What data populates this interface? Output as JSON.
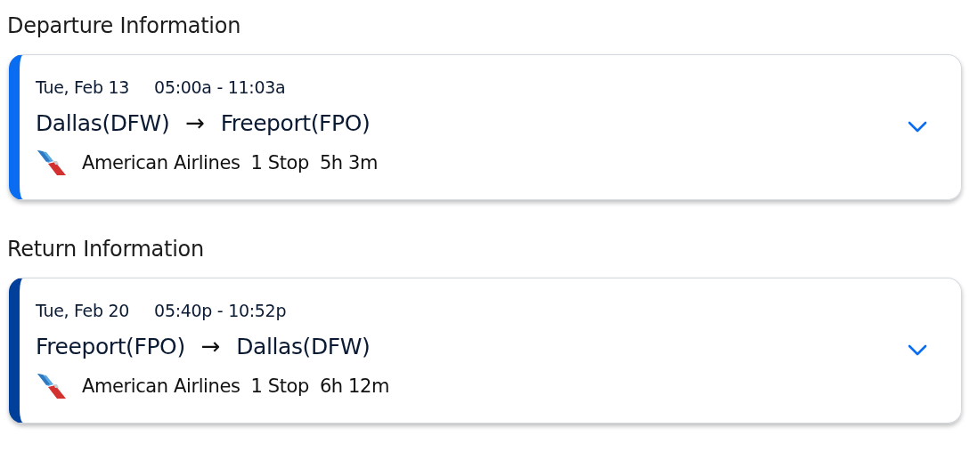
{
  "sections": [
    {
      "heading": "Departure Information",
      "color": "#0a6cf0",
      "date": "Tue, Feb 13",
      "time": "05:00a - 11:03a",
      "origin": "Dallas(DFW)",
      "arrow": "→",
      "destination": "Freeport(FPO)",
      "airline": "American Airlines",
      "stops": "1 Stop",
      "duration": "5h 3m"
    },
    {
      "heading": "Return Information",
      "color": "#003f9a",
      "date": "Tue, Feb 20",
      "time": "05:40p - 10:52p",
      "origin": "Freeport(FPO)",
      "arrow": "→",
      "destination": "Dallas(DFW)",
      "airline": "American Airlines",
      "stops": "1 Stop",
      "duration": "6h 12m"
    }
  ]
}
